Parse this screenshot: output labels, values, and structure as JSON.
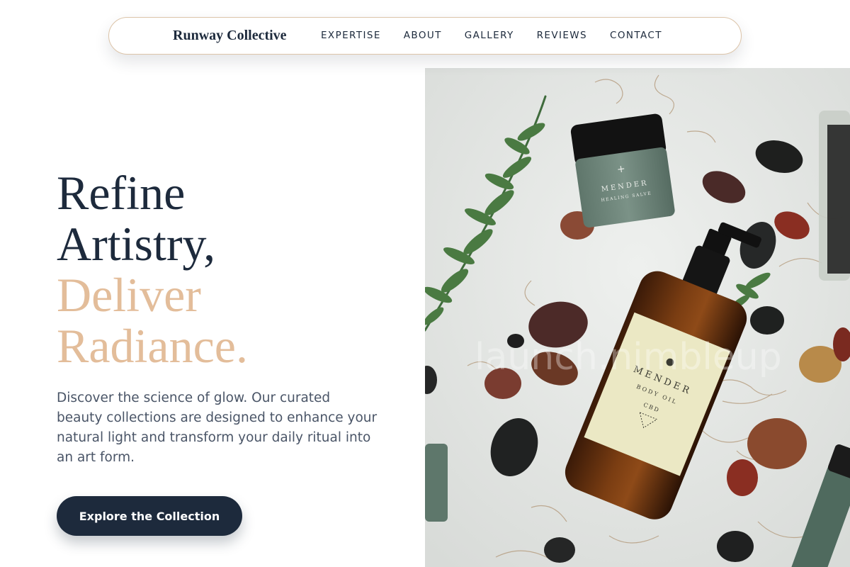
{
  "nav": {
    "brand": "Runway Collective",
    "links": [
      "EXPERTISE",
      "ABOUT",
      "GALLERY",
      "REVIEWS",
      "CONTACT"
    ]
  },
  "hero": {
    "headline_line1": "Refine",
    "headline_line2": "Artistry,",
    "headline_line3": "Deliver",
    "headline_line4": "Radiance.",
    "description": "Discover the science of glow. Our curated beauty collections are designed to enhance your natural light and transform your daily ritual into an art form.",
    "cta_label": "Explore the Collection"
  },
  "image": {
    "jar_brand": "MENDER",
    "jar_product": "HEALING SALVE",
    "bottle_brand": "MENDER",
    "bottle_product": "BODY OIL",
    "bottle_sub": "CBD",
    "watermark": "launch.nimbleup"
  },
  "colors": {
    "primary": "#1d2a3c",
    "accent": "#e3bd9a",
    "body_text": "#4a5567",
    "nav_border": "#dcc4a8"
  }
}
